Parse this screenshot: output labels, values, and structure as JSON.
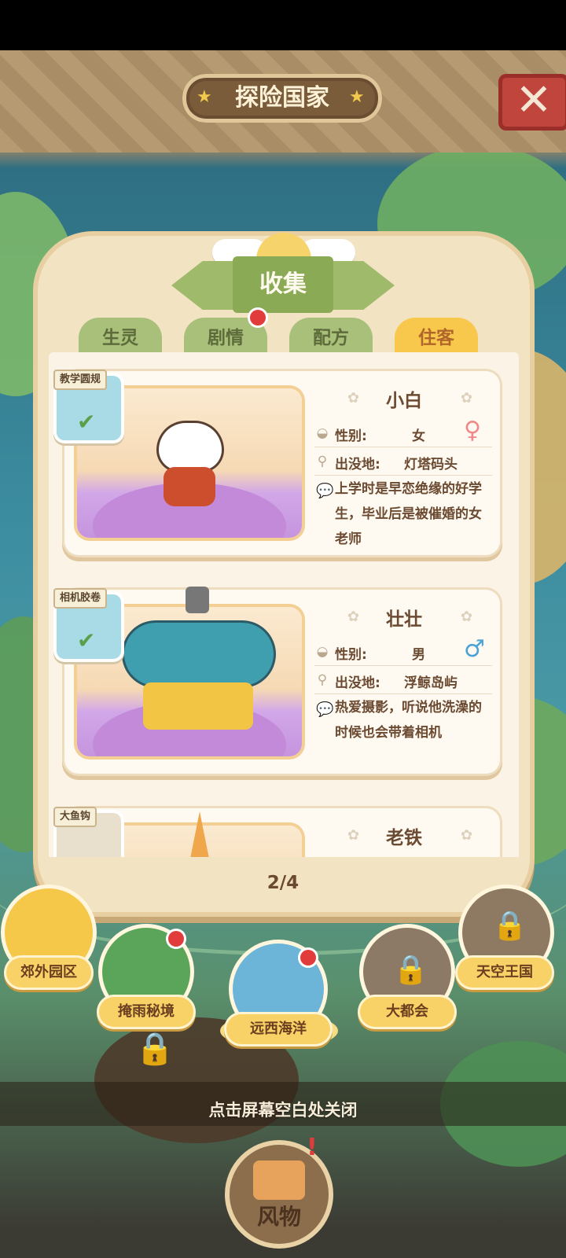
{
  "header": {
    "title": "探险国家"
  },
  "panel": {
    "title": "收集",
    "tabs": [
      {
        "label": "生灵",
        "active": false,
        "badge": false
      },
      {
        "label": "剧情",
        "active": false,
        "badge": true
      },
      {
        "label": "配方",
        "active": false,
        "badge": false
      },
      {
        "label": "住客",
        "active": true,
        "badge": false
      }
    ],
    "residents": [
      {
        "tag": "教学圆规",
        "name": "小白",
        "gender_label": "性别:",
        "gender": "女",
        "location_label": "出没地:",
        "location": "灯塔码头",
        "description": "上学时是早恋绝缘的好学生，毕业后是被催婚的女老师",
        "gender_symbol": "♀"
      },
      {
        "tag": "相机胶卷",
        "name": "壮壮",
        "gender_label": "性别:",
        "gender": "男",
        "location_label": "出没地:",
        "location": "浮鲸岛屿",
        "description": "热爱摄影，听说他洗澡的时候也会带着相机",
        "gender_symbol": "♂"
      },
      {
        "tag": "大鱼钩",
        "name": "老铁",
        "gender_symbol": "♂"
      }
    ],
    "pager": "2/4"
  },
  "map": {
    "regions": [
      {
        "label": "郊外园区",
        "locked": false,
        "badge": false
      },
      {
        "label": "掩雨秘境",
        "locked": false,
        "badge": true
      },
      {
        "label": "远西海洋",
        "locked": false,
        "badge": true,
        "selected": true
      },
      {
        "label": "大都会",
        "locked": true,
        "badge": false
      },
      {
        "label": "天空王国",
        "locked": true,
        "badge": false
      }
    ],
    "hint": "点击屏幕空白处关闭"
  },
  "bottom": {
    "button_label": "风物",
    "alert": "!"
  },
  "icons": {
    "close": "close-icon",
    "lock": "lock-icon",
    "check": "check-icon"
  },
  "colors": {
    "tab_active": "#f7c84b",
    "tab_inactive": "#a9c07a",
    "badge": "#e23b3b",
    "label_pill": "#f9d267"
  }
}
